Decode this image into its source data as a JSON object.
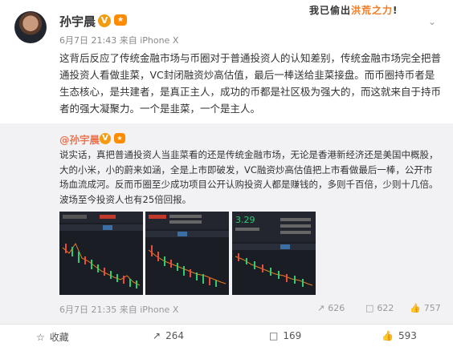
{
  "banner": {
    "prefix": "我已偷出",
    "highlight": "洪荒之力",
    "suffix": "!"
  },
  "post": {
    "author": "孙宇晨",
    "verified_mark": "V",
    "vip_mark": "vip",
    "time": "6月7日 21:43",
    "source": "来自 iPhone X",
    "text": "这背后反应了传统金融市场与币圈对于普通投资人的认知差别，传统金融市场完全把普通投资人看做韭菜，VC封闭融资炒高估值，最后一棒送给韭菜接盘。而币圈持币者是生态核心，是共建者，是真正主人，成功的币都是社区极为强大的，而这就来自于持币者的强大凝聚力。一个是韭菜，一个是主人。"
  },
  "repost": {
    "author": "@孙宇晨",
    "text": "说实话，真把普通投资人当韭菜看的还是传统金融市场，无论是香港新经济还是美国中概股，大的小米，小的蔚来如涵，全是上市即破发，VC融资炒高估值把上市看做最后一棒，公开市场血流成河。反而币圈至少成功项目公开认购投资人都是赚钱的，多则千百倍，少则十几倍。波场至今投资人也有25倍回报。",
    "time": "6月7日 21:35",
    "source": "来自 iPhone X",
    "stats": {
      "reposts": "626",
      "comments": "622",
      "likes": "757"
    },
    "thumb3_price": "3.29"
  },
  "actions": {
    "favorite": "收藏",
    "repost": "264",
    "comment": "169",
    "like": "593"
  },
  "colors": {
    "name_orange": "#eb7350",
    "accent": "#f07a22",
    "candle_up": "#e74c3c",
    "candle_down": "#2ecc71"
  }
}
